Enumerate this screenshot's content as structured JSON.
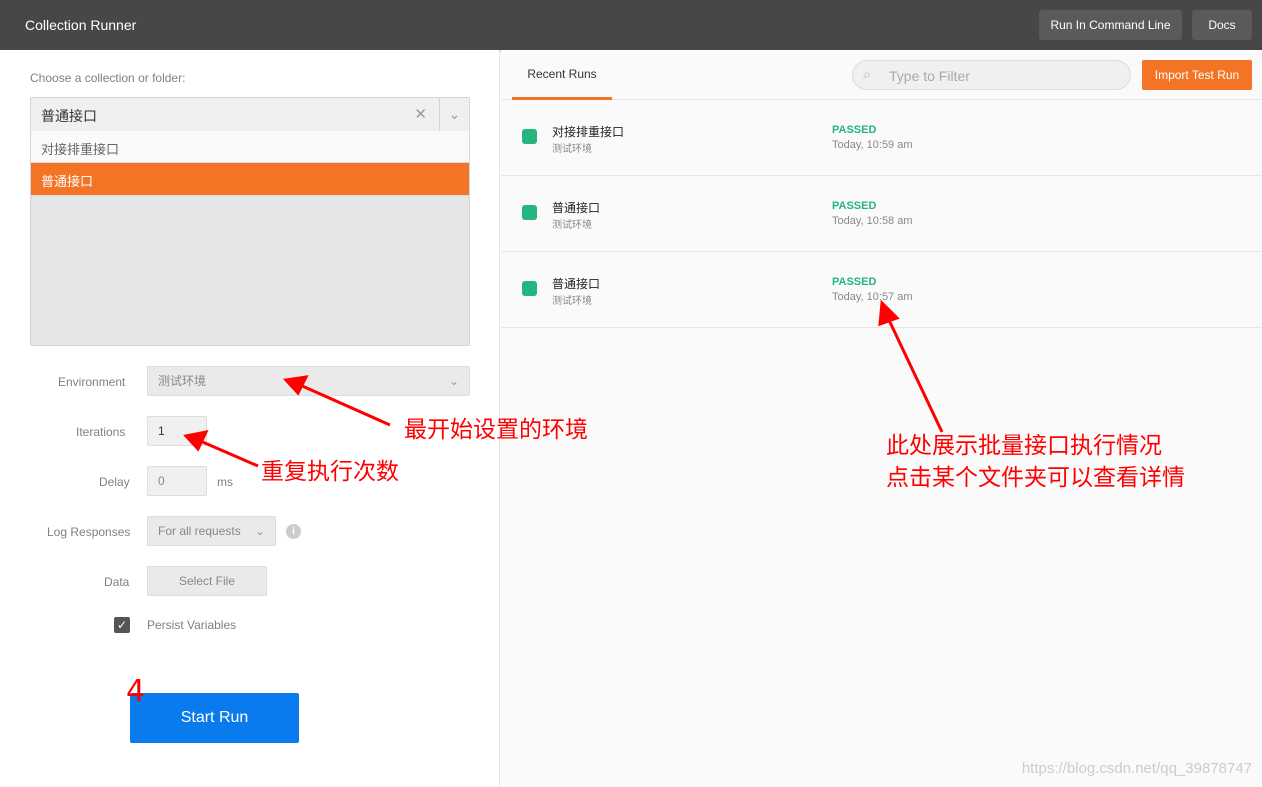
{
  "header": {
    "title": "Collection Runner",
    "run_cmd": "Run In Command Line",
    "docs": "Docs"
  },
  "left": {
    "choose_label": "Choose a collection or folder:",
    "selected": "普通接口",
    "options": [
      "对接排重接口",
      "普通接口"
    ],
    "environment_label": "Environment",
    "environment_value": "测试环境",
    "iterations_label": "Iterations",
    "iterations_value": "1",
    "delay_label": "Delay",
    "delay_value": "0",
    "delay_unit": "ms",
    "log_label": "Log Responses",
    "log_value": "For all requests",
    "data_label": "Data",
    "select_file": "Select File",
    "persist_label": "Persist Variables",
    "persist_checked": true,
    "start_run": "Start Run"
  },
  "right": {
    "tab": "Recent Runs",
    "filter_placeholder": "Type to Filter",
    "import": "Import Test Run",
    "runs": [
      {
        "name": "对接排重接口",
        "env": "测试环境",
        "status": "PASSED",
        "time": "Today, 10:59 am"
      },
      {
        "name": "普通接口",
        "env": "测试环境",
        "status": "PASSED",
        "time": "Today, 10:58 am"
      },
      {
        "name": "普通接口",
        "env": "测试环境",
        "status": "PASSED",
        "time": "Today, 10:57 am"
      }
    ]
  },
  "annotations": {
    "env": "最开始设置的环境",
    "iter": "重复执行次数",
    "runs1": "此处展示批量接口执行情况",
    "runs2": "点击某个文件夹可以查看详情",
    "num": "4"
  },
  "watermark": "https://blog.csdn.net/qq_39878747",
  "colors": {
    "accent": "#f47425",
    "passed": "#26b47f",
    "primary": "#097bed"
  }
}
